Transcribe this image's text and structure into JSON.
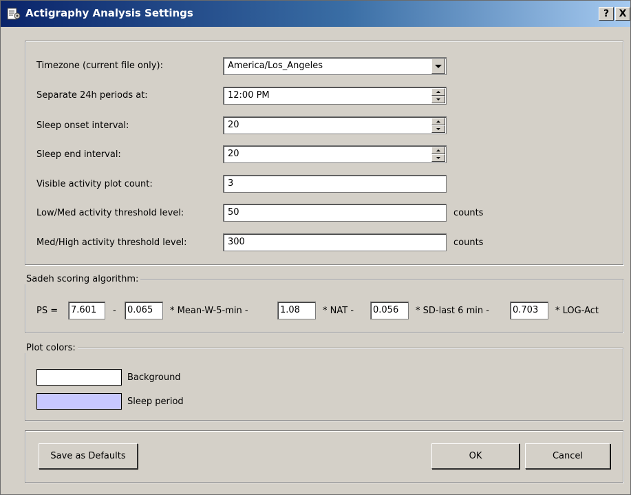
{
  "window": {
    "title": "Actigraphy Analysis Settings",
    "help_button": "?",
    "close_button": "X"
  },
  "settings": {
    "timezone_label": "Timezone (current file only):",
    "timezone_value": "America/Los_Angeles",
    "separate_label": "Separate 24h periods at:",
    "separate_value": "12:00 PM",
    "onset_label": "Sleep onset interval:",
    "onset_value": "20",
    "end_label": "Sleep end interval:",
    "end_value": "20",
    "plot_count_label": "Visible activity plot count:",
    "plot_count_value": "3",
    "low_med_label": "Low/Med activity threshold level:",
    "low_med_value": "50",
    "low_med_unit": "counts",
    "med_high_label": "Med/High activity threshold level:",
    "med_high_value": "300",
    "med_high_unit": "counts"
  },
  "sadeh": {
    "legend": "Sadeh scoring algorithm:",
    "ps_label": "PS =",
    "c0": "7.601",
    "minus1": "-",
    "c1": "0.065",
    "term1": "* Mean-W-5-min -",
    "c2": "1.08",
    "term2": "* NAT -",
    "c3": "0.056",
    "term3": "* SD-last 6 min -",
    "c4": "0.703",
    "term4": "* LOG-Act"
  },
  "colors": {
    "legend": "Plot colors:",
    "background_label": "Background",
    "background_color": "#ffffff",
    "sleep_label": "Sleep period",
    "sleep_color": "#c8c8ff"
  },
  "buttons": {
    "save_defaults": "Save as Defaults",
    "ok": "OK",
    "cancel": "Cancel"
  }
}
